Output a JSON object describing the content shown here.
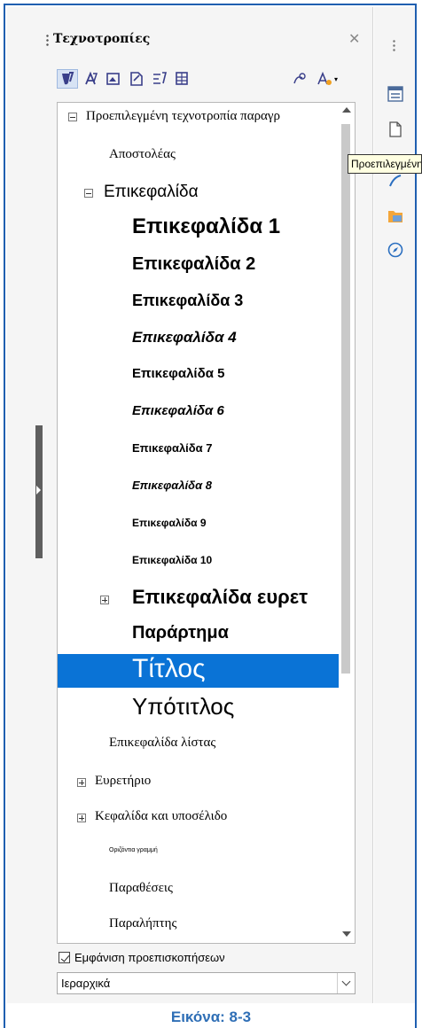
{
  "panel": {
    "title": "Τεχνοτροπίες",
    "toolbar_icons": [
      "paragraph-styles-icon",
      "character-styles-icon",
      "frame-styles-icon",
      "page-styles-icon",
      "list-styles-icon",
      "table-styles-icon",
      "fill-format-icon",
      "new-style-icon"
    ]
  },
  "tree": {
    "items": [
      {
        "label": "Προεπιλεγμένη τεχνοτροπία παραγρ",
        "expander": "minus"
      },
      {
        "label": "Αποστολέας"
      },
      {
        "label": "Επικεφαλίδα",
        "expander": "minus"
      },
      {
        "label": "Επικεφαλίδα 1"
      },
      {
        "label": "Επικεφαλίδα 2"
      },
      {
        "label": "Επικεφαλίδα 3"
      },
      {
        "label": "Επικεφαλίδα 4"
      },
      {
        "label": "Επικεφαλίδα 5"
      },
      {
        "label": "Επικεφαλίδα 6"
      },
      {
        "label": "Επικεφαλίδα 7"
      },
      {
        "label": "Επικεφαλίδα 8"
      },
      {
        "label": "Επικεφαλίδα 9"
      },
      {
        "label": "Επικεφαλίδα 10"
      },
      {
        "label": "Επικεφαλίδα ευρετ",
        "expander": "plus"
      },
      {
        "label": "Παράρτημα"
      },
      {
        "label": "Τίτλος",
        "selected": true
      },
      {
        "label": "Υπότιτλος"
      },
      {
        "label": "Επικεφαλίδα λίστας"
      },
      {
        "label": "Ευρετήριο",
        "expander": "plus"
      },
      {
        "label": "Κεφαλίδα και υποσέλιδο",
        "expander": "plus"
      },
      {
        "label": "Οριζόντια γραμμή"
      },
      {
        "label": "Παραθέσεις"
      },
      {
        "label": "Παραλήπτης"
      }
    ]
  },
  "preview": {
    "label": "Εμφάνιση προεπισκοπήσεων",
    "checked": true
  },
  "filter": {
    "value": "Ιεραρχικά"
  },
  "tooltip": "Προεπιλεγμένη",
  "sidebar_tabs": [
    "properties-icon",
    "page-icon",
    "styles-icon",
    "gallery-icon",
    "navigator-icon"
  ],
  "caption": "Εικόνα: 8-3",
  "colors": {
    "selection": "#0a73d6",
    "frame": "#1f5fb0",
    "caption": "#2f6fb6"
  }
}
